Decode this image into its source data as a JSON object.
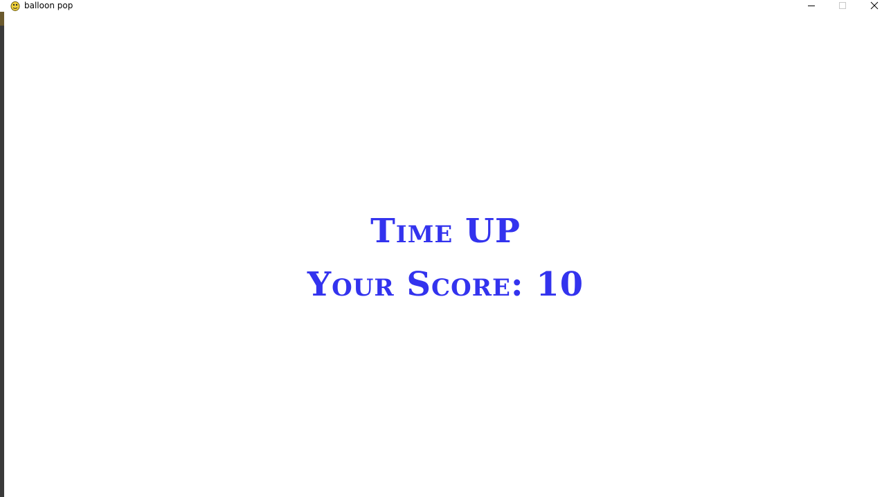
{
  "window": {
    "title": "balloon pop"
  },
  "game": {
    "headline": "Time UP",
    "score_label": "Your Score:",
    "score_value": "10",
    "text_color": "#3333ee"
  },
  "icons": {
    "app": "pygame-snake-icon",
    "minimize": "minimize-icon",
    "maximize": "maximize-icon",
    "close": "close-icon"
  }
}
